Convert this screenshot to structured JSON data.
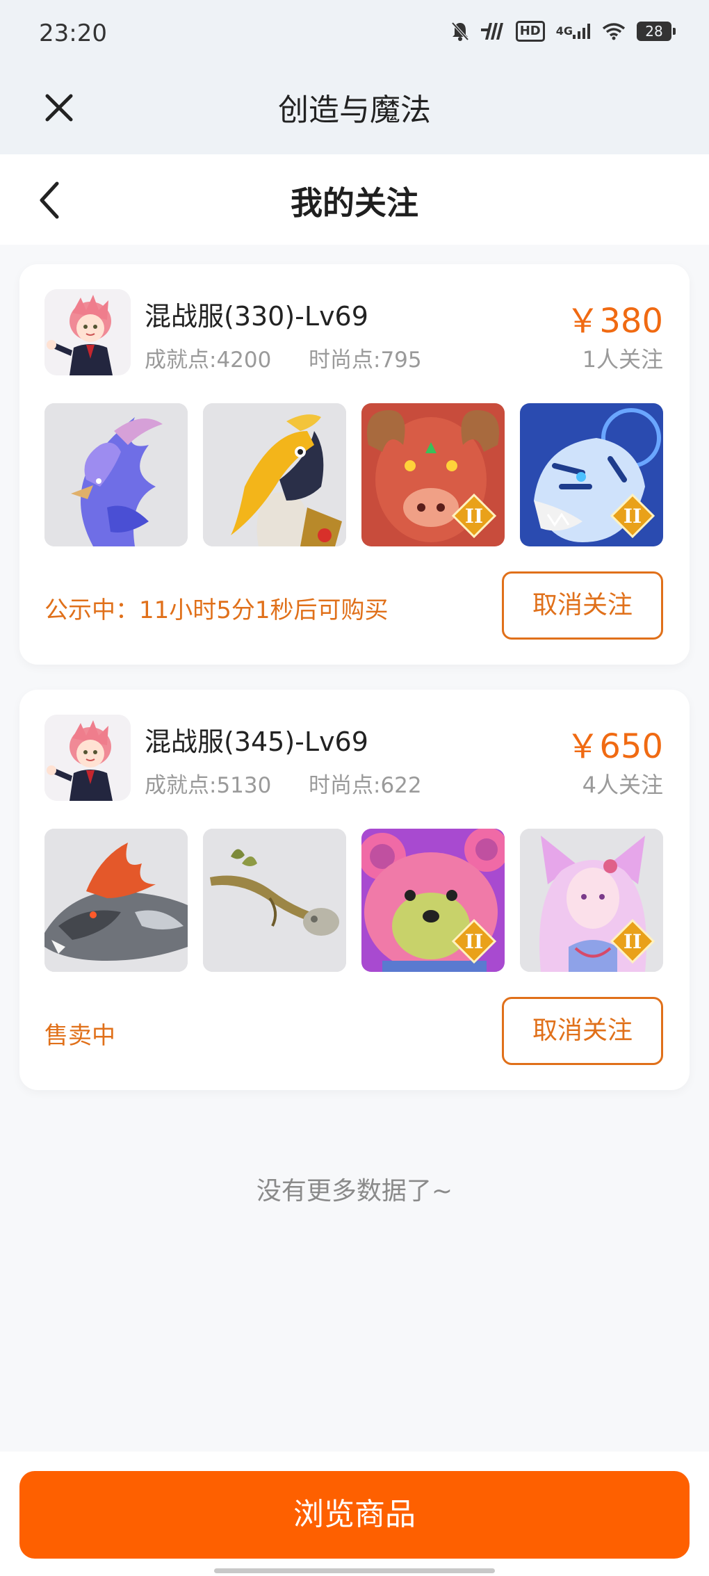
{
  "status_bar": {
    "time": "23:20",
    "network": "4G",
    "hd": "HD",
    "battery": "28"
  },
  "app_bar": {
    "title": "创造与魔法"
  },
  "page_header": {
    "title": "我的关注"
  },
  "listings": [
    {
      "title": "混战服(330)-Lv69",
      "achievement": "成就点:4200",
      "fashion": "时尚点:795",
      "price": "￥380",
      "followers": "1人关注",
      "status": "公示中：11小时5分1秒后可购买",
      "unfollow_label": "取消关注",
      "thumbnails": [
        {
          "name": "blue-phoenix",
          "badge": false
        },
        {
          "name": "hornbill-bird",
          "badge": false
        },
        {
          "name": "red-bull-beast",
          "badge": true,
          "badge_text": "II"
        },
        {
          "name": "blue-tiger",
          "badge": true,
          "badge_text": "II"
        }
      ]
    },
    {
      "title": "混战服(345)-Lv69",
      "achievement": "成就点:5130",
      "fashion": "时尚点:622",
      "price": "￥650",
      "followers": "4人关注",
      "status": "售卖中",
      "unfollow_label": "取消关注",
      "thumbnails": [
        {
          "name": "grey-dragon",
          "badge": false
        },
        {
          "name": "wooden-staff",
          "badge": false
        },
        {
          "name": "pink-bear-mount",
          "badge": true,
          "badge_text": "II"
        },
        {
          "name": "fox-spirit-girl",
          "badge": true,
          "badge_text": "II"
        }
      ]
    }
  ],
  "footer": {
    "no_more": "没有更多数据了~",
    "browse_label": "浏览商品"
  },
  "colors": {
    "accent": "#fe6000",
    "price": "#f06a12",
    "status": "#e0701a"
  }
}
